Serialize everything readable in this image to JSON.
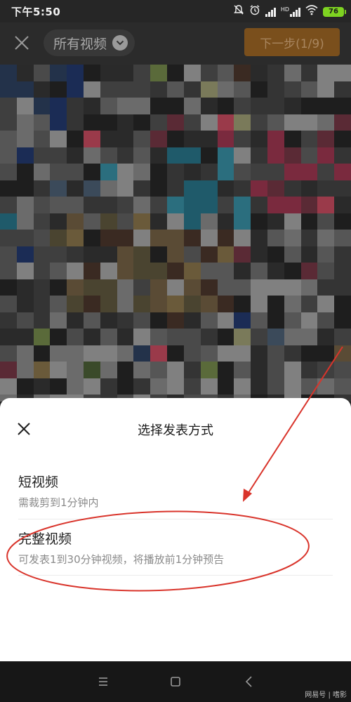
{
  "status_bar": {
    "time": "下午5:50",
    "network_label": "HD",
    "battery_level": "76",
    "icons": [
      "mute-icon",
      "alarm-icon",
      "signal-icon",
      "signal-hd-icon",
      "wifi-icon",
      "battery-icon"
    ]
  },
  "top_bar": {
    "close_icon": "close-icon",
    "album_label": "所有视频",
    "album_dropdown_icon": "chevron-down-icon",
    "next_label": "下一步(1/9)"
  },
  "sheet": {
    "title": "选择发表方式",
    "close_icon": "close-icon",
    "options": [
      {
        "title": "短视频",
        "subtitle": "需裁剪到1分钟内"
      },
      {
        "title": "完整视频",
        "subtitle": "可发表1到30分钟视频，将播放前1分钟预告"
      }
    ]
  },
  "nav_bar": {
    "icons": [
      "menu-icon",
      "home-icon",
      "back-icon"
    ]
  },
  "watermark": "网易号 | 嗜影",
  "colors": {
    "accent_button": "#7a4f1c",
    "annotation_red": "#d9342b",
    "sheet_background": "#ffffff"
  }
}
